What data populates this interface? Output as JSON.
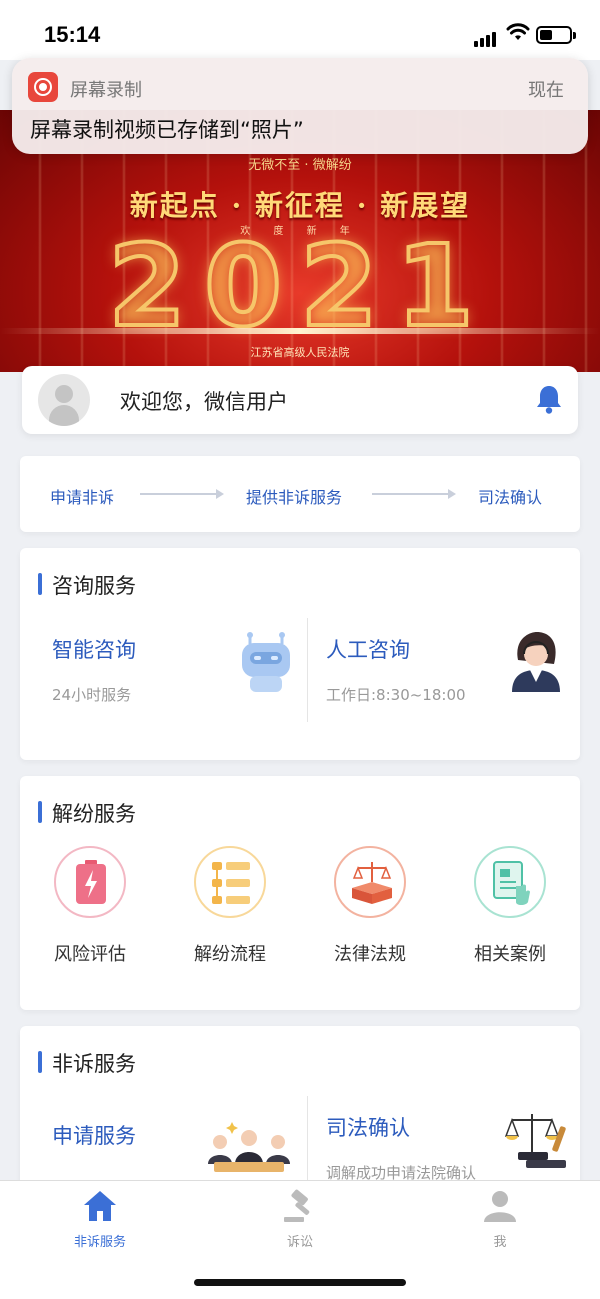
{
  "status_bar": {
    "time": "15:14"
  },
  "notification": {
    "app_name": "屏幕录制",
    "time_label": "现在",
    "message": "屏幕录制视频已存储到“照片”"
  },
  "banner": {
    "top_text": "无微不至 · 微解纷",
    "slogan": "新起点 · 新征程 · 新展望",
    "subtitle": "欢 度 新 年",
    "year": "2021",
    "organization": "江苏省高级人民法院"
  },
  "welcome": {
    "text": "欢迎您，微信用户"
  },
  "flow": {
    "steps": [
      "申请非诉",
      "提供非诉服务",
      "司法确认"
    ]
  },
  "consult": {
    "title": "咨询服务",
    "smart": {
      "title": "智能咨询",
      "subtitle": "24小时服务"
    },
    "human": {
      "title": "人工咨询",
      "subtitle": "工作日:8:30~18:00"
    }
  },
  "dispute": {
    "title": "解纷服务",
    "items": [
      {
        "label": "风险评估",
        "icon": "battery-risk-icon",
        "color": "#e85a72"
      },
      {
        "label": "解纷流程",
        "icon": "flowchart-icon",
        "color": "#f3b54a"
      },
      {
        "label": "法律法规",
        "icon": "law-book-icon",
        "color": "#e2603f"
      },
      {
        "label": "相关案例",
        "icon": "case-document-icon",
        "color": "#4fc1a6"
      }
    ]
  },
  "nonlitigation": {
    "title": "非诉服务",
    "apply": {
      "title": "申请服务"
    },
    "confirm": {
      "title": "司法确认",
      "subtitle": "调解成功申请法院确认"
    }
  },
  "tabbar": {
    "tabs": [
      {
        "label": "非诉服务",
        "active": true,
        "icon": "home-icon"
      },
      {
        "label": "诉讼",
        "active": false,
        "icon": "gavel-icon"
      },
      {
        "label": "我",
        "active": false,
        "icon": "user-icon"
      }
    ],
    "active_color": "#3b6fd6",
    "inactive_color": "#999999"
  }
}
